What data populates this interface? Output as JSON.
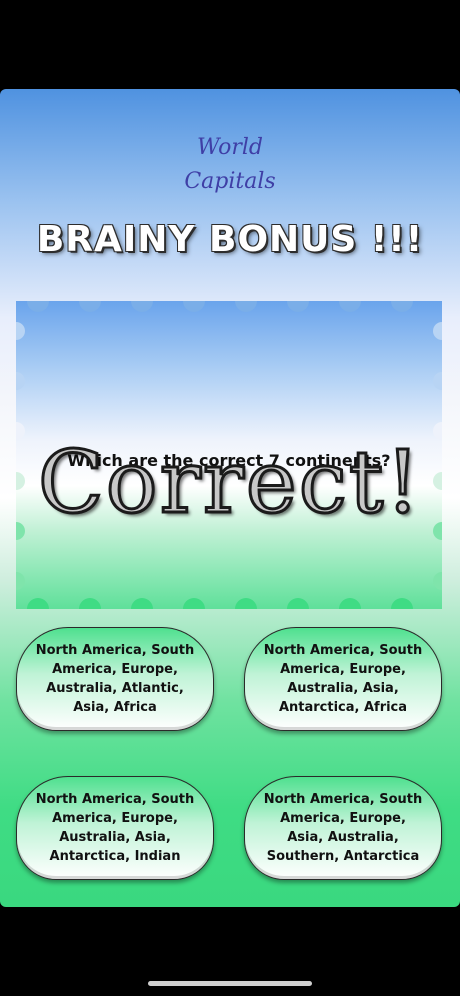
{
  "header": {
    "subject_line1": "World",
    "subject_line2": "Capitals",
    "bonus_title": "BRAINY BONUS !!!"
  },
  "question": {
    "text": "Which are the correct 7 continents?",
    "result": "Correct!"
  },
  "answers": [
    {
      "label": "North America, South America, Europe, Australia, Atlantic, Asia, Africa"
    },
    {
      "label": "North America, South America, Europe, Australia, Asia, Antarctica, Africa"
    },
    {
      "label": "North America, South America, Europe, Australia, Asia, Antarctica, Indian"
    },
    {
      "label": "North America, South America, Europe, Asia, Australia, Southern, Antarctica"
    }
  ],
  "colors": {
    "subject": "#3f3fa6",
    "accent_top": "#4f92e0",
    "accent_bottom": "#3ad87f"
  }
}
